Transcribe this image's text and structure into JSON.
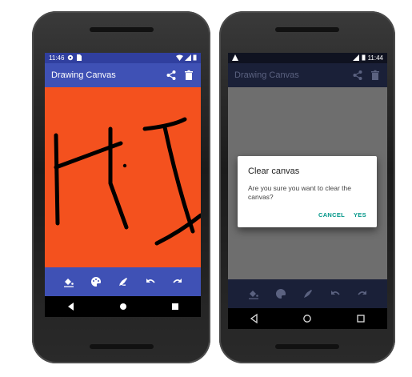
{
  "left_phone": {
    "status": {
      "time": "11:46"
    },
    "app_title": "Drawing Canvas",
    "colors": {
      "appbar": "#3F51B5",
      "canvas": "#F4511E",
      "toolbar": "#3F51B5",
      "ink": "#000000"
    },
    "icons": {
      "actions": [
        "share-icon",
        "delete-icon"
      ],
      "tools": [
        "fill-bucket-icon",
        "palette-icon",
        "brush-size-icon",
        "undo-icon",
        "redo-icon"
      ],
      "nav": [
        "back-icon",
        "home-icon",
        "recents-icon"
      ]
    }
  },
  "right_phone": {
    "status": {
      "time": "11:44"
    },
    "app_title": "Drawing Canvas",
    "dialog": {
      "title": "Clear canvas",
      "message": "Are you sure you want to clear the canvas?",
      "cancel_label": "CANCEL",
      "confirm_label": "YES"
    },
    "colors": {
      "appbar": "#1A2038",
      "scrim_canvas": "#6E6E6E",
      "toolbar": "#1A2038",
      "accent": "#009688"
    }
  }
}
